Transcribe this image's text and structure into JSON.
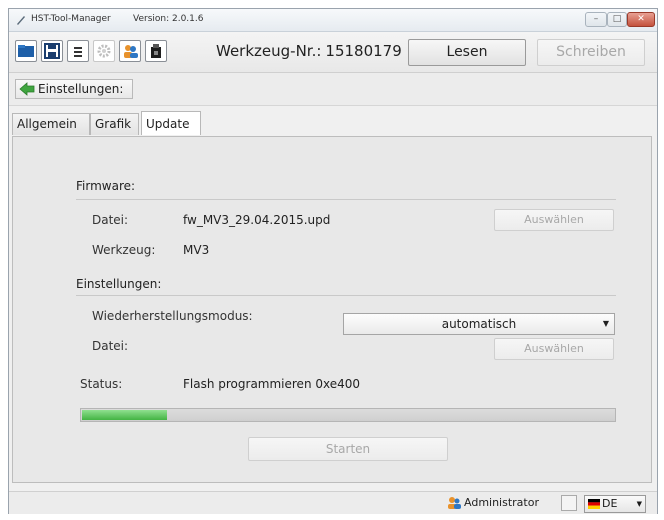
{
  "window": {
    "title": "HST-Tool-Manager",
    "version": "Version: 2.0.1.6"
  },
  "toolbar": {
    "icons": [
      "folder-icon",
      "save-icon",
      "list-icon",
      "gear-icon",
      "users-icon",
      "usb-device-icon"
    ],
    "tool_number_label": "Werkzeug-Nr.:",
    "tool_number_value": "15180179",
    "read_button": "Lesen",
    "write_button": "Schreiben"
  },
  "header": {
    "back_label": "Einstellungen:"
  },
  "tabs": [
    {
      "label": "Allgemein",
      "active": false
    },
    {
      "label": "Grafik",
      "active": false
    },
    {
      "label": "Update",
      "active": true
    }
  ],
  "update": {
    "firmware_section": "Firmware:",
    "file_label": "Datei:",
    "file_value": "fw_MV3_29.04.2015.upd",
    "select_button": "Auswählen",
    "tool_label": "Werkzeug:",
    "tool_value": "MV3",
    "settings_section": "Einstellungen:",
    "recovery_label": "Wiederherstellungsmodus:",
    "recovery_value": "automatisch",
    "file2_label": "Datei:",
    "select_button2": "Auswählen",
    "status_label": "Status:",
    "status_text": "Flash programmieren  0xe400",
    "progress_fraction": 0.16,
    "start_button": "Starten"
  },
  "statusbar": {
    "user": "Administrator",
    "language": "DE"
  },
  "colors": {
    "progress_fill": "#43b443",
    "disabled_text": "#a8a8a8"
  }
}
